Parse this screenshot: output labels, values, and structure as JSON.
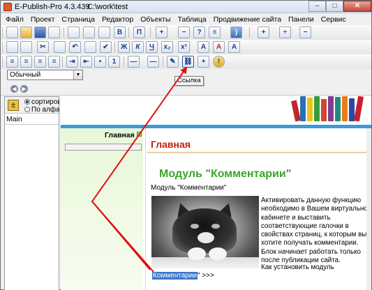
{
  "window": {
    "app_title": "E-Publish-Pro 4.3.439",
    "path": "C:\\work\\test"
  },
  "menu": [
    "Файл",
    "Проект",
    "Страница",
    "Редактор",
    "Объекты",
    "Таблица",
    "Продвижение сайта",
    "Панели",
    "Сервис"
  ],
  "toolbar1_icons": [
    "new-page-icon",
    "open-folder-icon",
    "save-icon",
    "image-icon",
    "paste-special-icon",
    "preview-icon",
    "upload-icon",
    "spell-check-icon",
    "property-icon",
    "add-icon",
    "remove-icon",
    "help-icon",
    "info-icon",
    "rss-icon",
    "table-insert-icon",
    "table-column-icon",
    "table-row-icon"
  ],
  "toolbar2_icons": [
    "cut-icon",
    "copy-icon",
    "paste-icon",
    "undo-icon",
    "redo-icon",
    "find-icon",
    "clear-format-icon",
    "bold-icon",
    "italic-icon",
    "underline-icon",
    "subscript-icon",
    "superscript-icon",
    "font-color-icon",
    "font-size-up-icon",
    "font-size-down-icon"
  ],
  "toolbar3_icons": [
    "align-left-icon",
    "align-center-icon",
    "align-right-icon",
    "justify-icon",
    "indent-icon",
    "outdent-icon",
    "bullets-icon",
    "numbering-icon",
    "hr-icon",
    "edit-icon",
    "link-icon",
    "anchor-icon",
    "insert-object-icon"
  ],
  "toolbar_labels": {
    "bold": "Ж",
    "italic": "К",
    "underline": "Ч",
    "font_a": "A"
  },
  "style_select": {
    "value": "Обычный"
  },
  "tooltip": "Ссылка",
  "left_panel": {
    "sort_option_1": "сортиров",
    "sort_option_2": "По алфав",
    "tree_root": "Main"
  },
  "site": {
    "nav_title": "Главная",
    "page_title": "Главная",
    "module_heading": "Модуль \"Комментарии\"",
    "module_sub": "Модуль \"Комментарии\"",
    "description": "Активировать данную функцию необходимо в Вашем виртуально кабинете и выставить соответствующие галочки в свойствах страниц, к которым вы хотите получать комментарии. Блок начинает работать только после публикации сайта.",
    "howto_link": "Как установить модуль",
    "comment_link_selected": "Комментарии",
    "comment_link_rest": "\" >>>"
  },
  "colors": {
    "page_title": "#c81d12",
    "module_heading": "#3aa629",
    "selection": "#3b75c9",
    "annotation_arrow": "#e01010",
    "band": "#3a9bd8"
  }
}
